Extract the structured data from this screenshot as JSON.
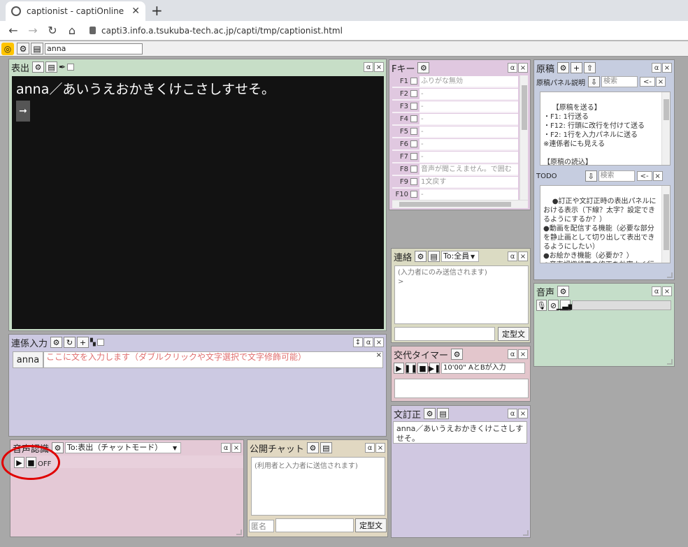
{
  "browser": {
    "tab_title": "captionist - captiOnline",
    "url": "capti3.info.a.tsukuba-tech.ac.jp/capti/tmp/captionist.html"
  },
  "toolbar": {
    "user_name": "anna"
  },
  "hyoshutsu": {
    "title": "表出",
    "alpha": "α",
    "close": "×",
    "text": "anna／あいうえおかきくけこさしすせそ。",
    "arrow": "➞"
  },
  "fkey": {
    "title": "Fキー",
    "alpha": "α",
    "close": "×",
    "items": [
      {
        "key": "F1",
        "value": "ふりがな無効"
      },
      {
        "key": "F2",
        "value": "-"
      },
      {
        "key": "F3",
        "value": "-"
      },
      {
        "key": "F4",
        "value": "-"
      },
      {
        "key": "F5",
        "value": "-"
      },
      {
        "key": "F6",
        "value": "-"
      },
      {
        "key": "F7",
        "value": "-"
      },
      {
        "key": "F8",
        "value": "音声が聞こえません。で囲む"
      },
      {
        "key": "F9",
        "value": "1文戻す"
      },
      {
        "key": "F10",
        "value": "-"
      }
    ]
  },
  "genko": {
    "title": "原稿",
    "alpha": "α",
    "close": "×",
    "section1": {
      "label": "原稿パネル説明",
      "search_placeholder": "検索",
      "back": "<-",
      "text": "【原稿を送る】\n・F1: 1行送る\n・F12: 行頭に改行を付けて送る\n・F2: 1行を入力パネルに送る\n※連係者にも見える\n\n【原稿の読込】\n・「⇧」ボタンでパスとファイルを選"
    },
    "section2": {
      "label": "TODO",
      "search_placeholder": "検索",
      "back": "<-",
      "text": "●訂正や文訂正時の表出パネルにおける表示（下線？太字？設定できるようにするか？）\n●動画を配信する機能（必要な部分を静止画として切り出して表出できるようにしたい）\n●お絵かき機能（必要か？）\n●音声認識結果の修正を効率よく行"
    }
  },
  "renraku": {
    "title": "連絡",
    "to": "To:全員",
    "alpha": "α",
    "close": "×",
    "text": "(入力者にのみ送信されます)\n>",
    "teikei": "定型文"
  },
  "koutai": {
    "title": "交代タイマー",
    "alpha": "α",
    "close": "×",
    "timer": "10'00\" AとBが入力"
  },
  "onsei": {
    "title": "音声",
    "alpha": "α",
    "close": "×"
  },
  "renkei": {
    "title": "連係入力",
    "alpha": "α",
    "close": "×",
    "user": "anna",
    "placeholder": "ここに文を入力します（ダブルクリックや文字選択で文字修飾可能）",
    "x": "×"
  },
  "bunteisei": {
    "title": "文訂正",
    "alpha": "α",
    "close": "×",
    "text": "anna／あいうえおかきくけこさしすせそ。"
  },
  "onsei_ninshiki": {
    "title": "音声認識",
    "to": "To:表出（チャットモード）",
    "alpha": "α",
    "close": "×",
    "status": "OFF"
  },
  "koukai": {
    "title": "公開チャット",
    "alpha": "α",
    "close": "×",
    "text": "(利用者と入力者に送信されます)",
    "name_label": "匿名",
    "teikei": "定型文"
  }
}
